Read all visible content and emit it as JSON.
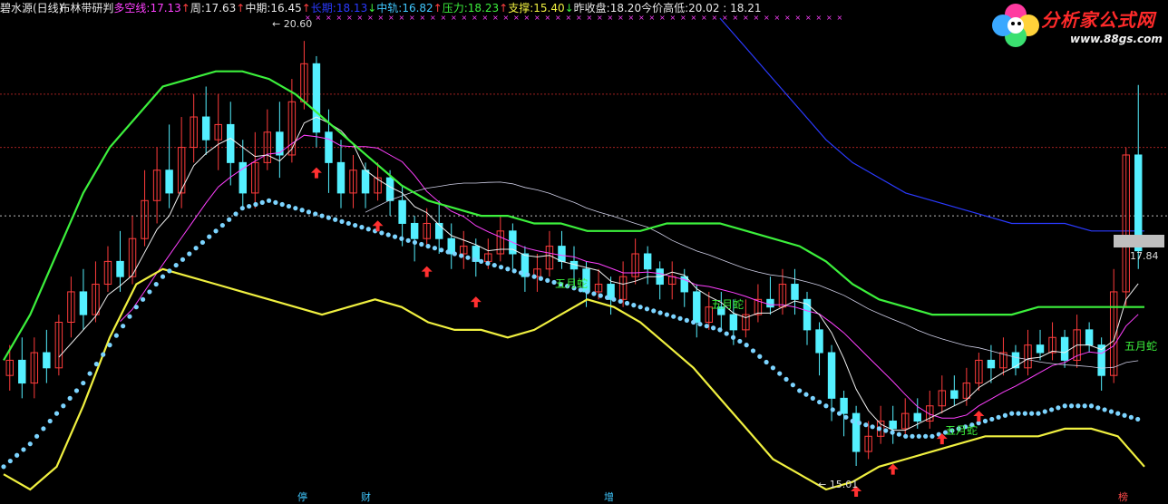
{
  "header": {
    "title": "碧水源(日线)",
    "indicator": "布林带研判",
    "items": [
      {
        "label": "多空线:",
        "value": "17.13",
        "arrow": "↑",
        "label_color": "#ff40ff",
        "value_color": "#ff40ff",
        "arrow_dir": "up"
      },
      {
        "label": "周:",
        "value": "17.63",
        "arrow": "↑",
        "label_color": "#e8e8e8",
        "value_color": "#e8e8e8",
        "arrow_dir": "up"
      },
      {
        "label": "中期:",
        "value": "16.45",
        "arrow": "↑",
        "label_color": "#e8e8e8",
        "value_color": "#e8e8e8",
        "arrow_dir": "up"
      },
      {
        "label": "长期:",
        "value": "18.13",
        "arrow": "↓",
        "label_color": "#2a3aff",
        "value_color": "#2a3aff",
        "arrow_dir": "down"
      },
      {
        "label": "中轨:",
        "value": "16.82",
        "arrow": "↑",
        "label_color": "#40c8ff",
        "value_color": "#40c8ff",
        "arrow_dir": "up"
      },
      {
        "label": "压力:",
        "value": "18.23",
        "arrow": "↑",
        "label_color": "#3cf03c",
        "value_color": "#3cf03c",
        "arrow_dir": "up"
      },
      {
        "label": "支撑:",
        "value": "15.40",
        "arrow": "↓",
        "label_color": "#f0f040",
        "value_color": "#f0f040",
        "arrow_dir": "down"
      },
      {
        "label": "昨收盘:",
        "value": "18.20",
        "arrow": "",
        "label_color": "#e8e8e8",
        "value_color": "#e8e8e8",
        "arrow_dir": "none"
      },
      {
        "label": "今价高低:",
        "value": "20.02 : 18.21",
        "arrow": "",
        "label_color": "#e8e8e8",
        "value_color": "#e8e8e8",
        "arrow_dir": "none"
      }
    ]
  },
  "logo": {
    "title": "分析家公式网",
    "url": "www.88gs.com"
  },
  "price_marker": "17.84",
  "annotations": {
    "high_label": "20.60",
    "low_label": "15.01",
    "snake_label": "五月蛇"
  },
  "events": [
    {
      "text": "停",
      "color": "#40c8ff"
    },
    {
      "text": "财",
      "color": "#40c8ff"
    },
    {
      "text": "增",
      "color": "#40c8ff"
    },
    {
      "text": "榜",
      "color": "#ff4a4a"
    }
  ],
  "colors": {
    "up_candle": "#ff3c3c",
    "down_candle": "#54f0ff",
    "upper_band": "#3cf03c",
    "lower_band": "#f0f040",
    "mid_band_dots": "#7cd4ff",
    "long_ma": "#2a3aff",
    "mid_ma": "#d0d0e8",
    "short_ma": "#ff40ff",
    "week_ma": "#f0f0f0",
    "signal_arrow": "#ff3030",
    "x_markers": "#ff40ff"
  },
  "chart_data": {
    "type": "candlestick",
    "title": "碧水源(日线) 布林带研判",
    "ylim": [
      14.7,
      20.9
    ],
    "dashed_levels": [
      19.9,
      19.2,
      18.3
    ],
    "high": 20.6,
    "low": 15.01,
    "last_price": 17.84,
    "candles": [
      [
        16.2,
        16.4,
        16.6,
        16.0
      ],
      [
        16.4,
        16.1,
        16.7,
        15.9
      ],
      [
        16.1,
        16.5,
        16.7,
        15.9
      ],
      [
        16.5,
        16.3,
        16.8,
        16.1
      ],
      [
        16.3,
        16.9,
        17.0,
        16.2
      ],
      [
        16.9,
        17.3,
        17.5,
        16.7
      ],
      [
        17.3,
        17.0,
        17.6,
        16.8
      ],
      [
        17.0,
        17.4,
        17.7,
        16.9
      ],
      [
        17.4,
        17.7,
        17.9,
        17.3
      ],
      [
        17.7,
        17.5,
        18.1,
        17.3
      ],
      [
        17.5,
        18.0,
        18.3,
        17.4
      ],
      [
        18.0,
        18.5,
        18.9,
        17.9
      ],
      [
        18.5,
        18.9,
        19.2,
        18.2
      ],
      [
        18.9,
        18.6,
        19.5,
        18.4
      ],
      [
        18.6,
        19.2,
        19.6,
        18.4
      ],
      [
        19.2,
        19.6,
        19.9,
        19.0
      ],
      [
        19.6,
        19.3,
        20.0,
        19.1
      ],
      [
        19.3,
        19.5,
        19.9,
        18.9
      ],
      [
        19.5,
        19.0,
        19.8,
        18.7
      ],
      [
        19.0,
        18.6,
        19.3,
        18.4
      ],
      [
        18.6,
        19.0,
        19.4,
        18.4
      ],
      [
        19.0,
        19.4,
        19.7,
        18.9
      ],
      [
        19.4,
        19.1,
        19.8,
        18.8
      ],
      [
        19.1,
        19.8,
        20.1,
        19.0
      ],
      [
        19.8,
        20.3,
        20.6,
        19.7
      ],
      [
        20.3,
        19.4,
        20.4,
        19.2
      ],
      [
        19.4,
        19.0,
        19.7,
        18.6
      ],
      [
        19.0,
        18.6,
        19.3,
        18.4
      ],
      [
        18.6,
        18.9,
        19.1,
        18.4
      ],
      [
        18.9,
        18.6,
        19.0,
        18.4
      ],
      [
        18.6,
        18.8,
        19.0,
        18.5
      ],
      [
        18.8,
        18.5,
        18.9,
        18.3
      ],
      [
        18.5,
        18.2,
        18.7,
        17.9
      ],
      [
        18.2,
        18.0,
        18.3,
        17.7
      ],
      [
        18.0,
        18.2,
        18.4,
        17.9
      ],
      [
        18.2,
        18.0,
        18.5,
        17.8
      ],
      [
        18.0,
        17.8,
        18.2,
        17.6
      ],
      [
        17.8,
        17.9,
        18.1,
        17.6
      ],
      [
        17.9,
        17.7,
        18.0,
        17.5
      ],
      [
        17.7,
        17.8,
        18.0,
        17.6
      ],
      [
        17.8,
        18.1,
        18.3,
        17.7
      ],
      [
        18.1,
        17.8,
        18.2,
        17.6
      ],
      [
        17.8,
        17.5,
        17.9,
        17.3
      ],
      [
        17.5,
        17.6,
        17.8,
        17.3
      ],
      [
        17.6,
        17.9,
        18.1,
        17.5
      ],
      [
        17.9,
        17.7,
        18.1,
        17.6
      ],
      [
        17.7,
        17.6,
        17.9,
        17.4
      ],
      [
        17.6,
        17.3,
        17.7,
        17.1
      ],
      [
        17.3,
        17.4,
        17.6,
        17.2
      ],
      [
        17.4,
        17.2,
        17.5,
        17.0
      ],
      [
        17.2,
        17.5,
        17.7,
        17.1
      ],
      [
        17.5,
        17.8,
        18.0,
        17.4
      ],
      [
        17.8,
        17.6,
        17.9,
        17.4
      ],
      [
        17.6,
        17.4,
        17.7,
        17.2
      ],
      [
        17.4,
        17.5,
        17.7,
        17.2
      ],
      [
        17.5,
        17.3,
        17.6,
        17.1
      ],
      [
        17.3,
        16.9,
        17.4,
        16.7
      ],
      [
        16.9,
        17.1,
        17.3,
        16.8
      ],
      [
        17.1,
        17.0,
        17.3,
        16.8
      ],
      [
        17.0,
        16.8,
        17.2,
        16.6
      ],
      [
        16.8,
        17.0,
        17.2,
        16.7
      ],
      [
        17.0,
        17.2,
        17.4,
        16.9
      ],
      [
        17.2,
        17.1,
        17.5,
        17.0
      ],
      [
        17.1,
        17.4,
        17.6,
        17.0
      ],
      [
        17.4,
        17.2,
        17.6,
        17.0
      ],
      [
        17.2,
        16.8,
        17.3,
        16.6
      ],
      [
        16.8,
        16.5,
        16.9,
        16.2
      ],
      [
        16.5,
        15.9,
        16.6,
        15.6
      ],
      [
        15.9,
        15.7,
        16.0,
        15.4
      ],
      [
        15.7,
        15.2,
        15.8,
        15.01
      ],
      [
        15.2,
        15.4,
        15.6,
        15.1
      ],
      [
        15.4,
        15.6,
        15.8,
        15.3
      ],
      [
        15.6,
        15.5,
        15.8,
        15.3
      ],
      [
        15.5,
        15.7,
        15.9,
        15.4
      ],
      [
        15.7,
        15.6,
        15.9,
        15.5
      ],
      [
        15.6,
        15.8,
        16.0,
        15.5
      ],
      [
        15.8,
        16.0,
        16.2,
        15.7
      ],
      [
        16.0,
        15.9,
        16.2,
        15.8
      ],
      [
        15.9,
        16.1,
        16.3,
        15.8
      ],
      [
        16.1,
        16.4,
        16.5,
        16.0
      ],
      [
        16.4,
        16.3,
        16.6,
        16.1
      ],
      [
        16.3,
        16.5,
        16.7,
        16.2
      ],
      [
        16.5,
        16.3,
        16.6,
        16.2
      ],
      [
        16.3,
        16.6,
        16.8,
        16.2
      ],
      [
        16.6,
        16.5,
        16.8,
        16.4
      ],
      [
        16.5,
        16.7,
        16.9,
        16.4
      ],
      [
        16.7,
        16.4,
        16.8,
        16.3
      ],
      [
        16.4,
        16.8,
        17.0,
        16.3
      ],
      [
        16.8,
        16.6,
        16.9,
        16.5
      ],
      [
        16.6,
        16.2,
        16.7,
        16.0
      ],
      [
        16.2,
        17.3,
        17.6,
        16.1
      ],
      [
        17.3,
        19.1,
        19.2,
        17.1
      ],
      [
        19.1,
        17.84,
        20.02,
        17.6
      ]
    ],
    "upper_band": [
      16.4,
      17.0,
      17.8,
      18.6,
      19.2,
      19.6,
      20.0,
      20.1,
      20.2,
      20.2,
      20.1,
      19.9,
      19.6,
      19.3,
      19.0,
      18.7,
      18.5,
      18.4,
      18.3,
      18.3,
      18.2,
      18.2,
      18.1,
      18.1,
      18.1,
      18.2,
      18.2,
      18.2,
      18.1,
      18.0,
      17.9,
      17.7,
      17.4,
      17.2,
      17.1,
      17.0,
      17.0,
      17.0,
      17.0,
      17.1,
      17.1,
      17.1,
      17.1,
      17.1
    ],
    "lower_band": [
      14.9,
      14.7,
      15.0,
      15.8,
      16.7,
      17.4,
      17.6,
      17.5,
      17.4,
      17.3,
      17.2,
      17.1,
      17.0,
      17.1,
      17.2,
      17.1,
      16.9,
      16.8,
      16.8,
      16.7,
      16.8,
      17.0,
      17.2,
      17.1,
      16.9,
      16.6,
      16.3,
      15.9,
      15.5,
      15.1,
      14.9,
      14.7,
      14.8,
      15.0,
      15.1,
      15.2,
      15.3,
      15.4,
      15.4,
      15.4,
      15.5,
      15.5,
      15.4,
      15.0
    ],
    "mid_band": [
      15.0,
      15.3,
      15.7,
      16.1,
      16.6,
      17.1,
      17.5,
      17.8,
      18.1,
      18.4,
      18.5,
      18.4,
      18.3,
      18.2,
      18.1,
      18.0,
      17.9,
      17.8,
      17.7,
      17.6,
      17.5,
      17.4,
      17.3,
      17.2,
      17.1,
      17.0,
      16.9,
      16.8,
      16.6,
      16.3,
      16.0,
      15.8,
      15.6,
      15.5,
      15.4,
      15.4,
      15.5,
      15.6,
      15.7,
      15.7,
      15.8,
      15.8,
      15.7,
      15.6
    ],
    "long_ma": [
      null,
      null,
      null,
      null,
      null,
      null,
      null,
      null,
      null,
      null,
      null,
      null,
      null,
      null,
      null,
      null,
      null,
      null,
      null,
      null,
      null,
      null,
      null,
      null,
      null,
      null,
      null,
      20.9,
      20.5,
      20.1,
      19.7,
      19.3,
      19.0,
      18.8,
      18.6,
      18.5,
      18.4,
      18.3,
      18.2,
      18.2,
      18.2,
      18.1,
      18.1,
      18.1
    ],
    "signal_arrows": 8
  }
}
